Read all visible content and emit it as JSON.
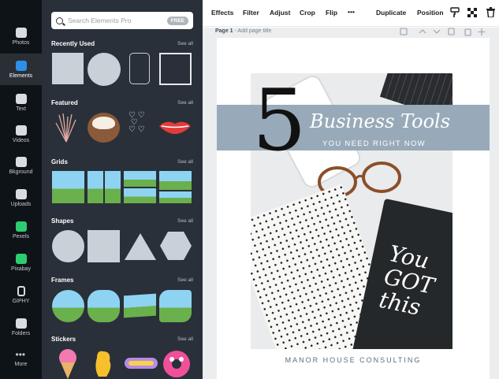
{
  "rail": [
    {
      "label": "Photos",
      "icon": "photo-icon"
    },
    {
      "label": "Elements",
      "icon": "elements-icon",
      "active": true
    },
    {
      "label": "Text",
      "icon": "text-icon"
    },
    {
      "label": "Videos",
      "icon": "video-icon"
    },
    {
      "label": "Bkground",
      "icon": "background-icon"
    },
    {
      "label": "Uploads",
      "icon": "upload-icon"
    },
    {
      "label": "Pexels",
      "icon": "pexels-icon"
    },
    {
      "label": "Pixabay",
      "icon": "pixabay-icon"
    },
    {
      "label": "GIPHY",
      "icon": "giphy-icon"
    },
    {
      "label": "Folders",
      "icon": "folder-icon"
    },
    {
      "label": "More",
      "icon": "more-icon"
    }
  ],
  "search": {
    "placeholder": "Search Elements Pro",
    "badge": "FREE"
  },
  "sections": [
    {
      "title": "Recently Used",
      "see_all": "See all"
    },
    {
      "title": "Featured",
      "see_all": "See all"
    },
    {
      "title": "Grids",
      "see_all": "See all"
    },
    {
      "title": "Shapes",
      "see_all": "See all"
    },
    {
      "title": "Frames",
      "see_all": "See all"
    },
    {
      "title": "Stickers",
      "see_all": "See all"
    }
  ],
  "toolbar": {
    "effects": "Effects",
    "filter": "Filter",
    "adjust": "Adjust",
    "crop": "Crop",
    "flip": "Flip",
    "more": "•••",
    "duplicate": "Duplicate",
    "position": "Position"
  },
  "page": {
    "label": "Page 1",
    "title_placeholder": "- Add page title"
  },
  "design": {
    "number": "5",
    "script_title": "Business Tools",
    "subtitle": "YOU NEED RIGHT NOW",
    "notebook_text": "You GOT this",
    "footer": "MANOR HOUSE CONSULTING"
  },
  "colors": {
    "accent": "#2f8fe8",
    "banner": "#98aab9",
    "panel": "#293039",
    "rail": "#0e1318"
  }
}
